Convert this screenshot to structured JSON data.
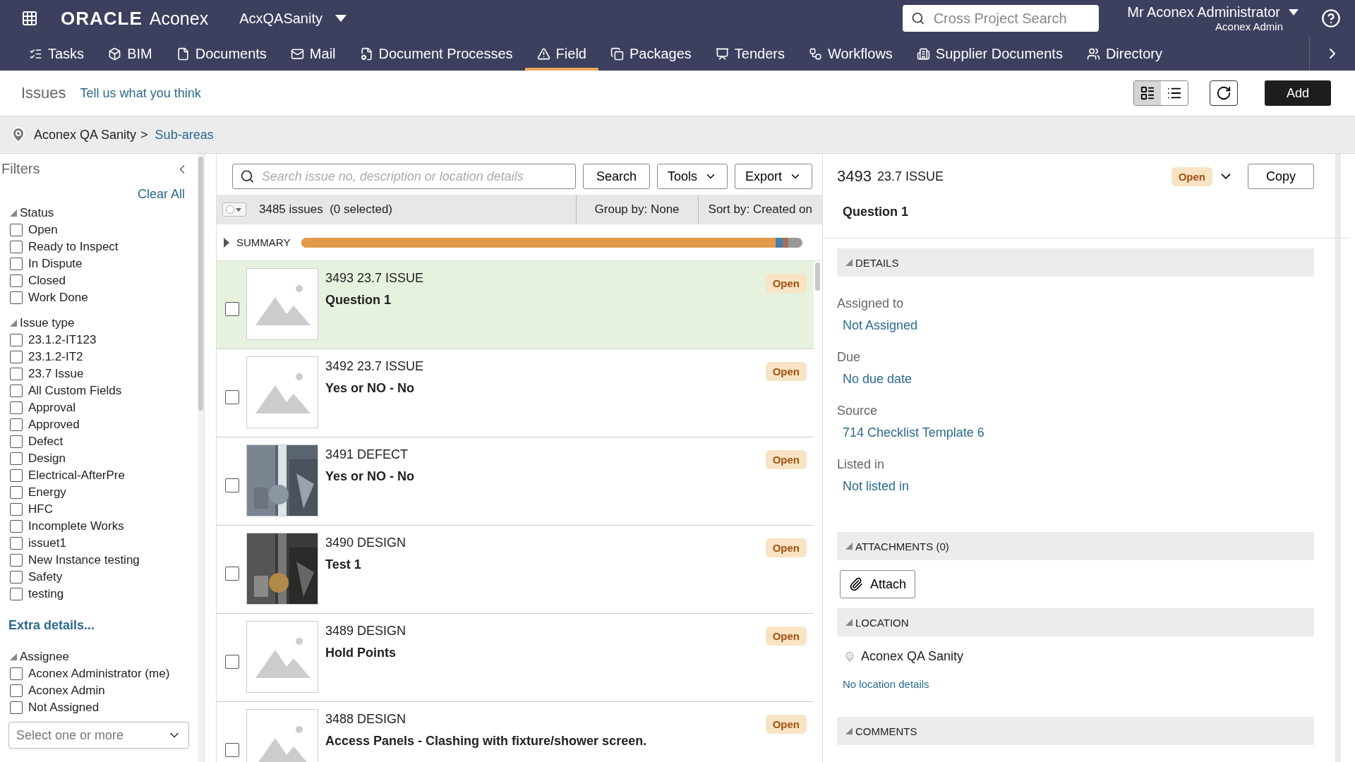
{
  "header": {
    "brand": "ORACLE",
    "product": "Aconex",
    "project": "AcxQASanity",
    "search": {
      "placeholder": "Cross Project Search"
    },
    "user": {
      "name": "Mr Aconex Administrator",
      "org": "Aconex Admin"
    }
  },
  "nav": [
    {
      "label": "Tasks",
      "selected": false
    },
    {
      "label": "BIM",
      "selected": false
    },
    {
      "label": "Documents",
      "selected": false
    },
    {
      "label": "Mail",
      "selected": false
    },
    {
      "label": "Document Processes",
      "selected": false
    },
    {
      "label": "Field",
      "selected": true
    },
    {
      "label": "Packages",
      "selected": false
    },
    {
      "label": "Tenders",
      "selected": false
    },
    {
      "label": "Workflows",
      "selected": false
    },
    {
      "label": "Supplier Documents",
      "selected": false
    },
    {
      "label": "Directory",
      "selected": false
    }
  ],
  "page": {
    "title": "Issues",
    "feedback_link": "Tell us what you think",
    "views": [
      {
        "selected": true
      },
      {
        "selected": false
      }
    ],
    "add_button": "Add"
  },
  "breadcrumb": {
    "root": "Aconex QA Sanity",
    "separator": ">",
    "current": "Sub-areas"
  },
  "filters": {
    "title": "Filters",
    "clear_all": "Clear All",
    "extra_details": "Extra details...",
    "select_placeholder": "Select one or more",
    "groups": [
      {
        "title": "Status",
        "items": [
          {
            "label": "Open",
            "checked": false
          },
          {
            "label": "Ready to Inspect",
            "checked": false
          },
          {
            "label": "In Dispute",
            "checked": false
          },
          {
            "label": "Closed",
            "checked": false
          },
          {
            "label": "Work Done",
            "checked": false
          }
        ]
      },
      {
        "title": "Issue type",
        "items": [
          {
            "label": "23.1.2-IT123",
            "checked": false
          },
          {
            "label": "23.1.2-IT2",
            "checked": false
          },
          {
            "label": "23.7 Issue",
            "checked": false
          },
          {
            "label": "All Custom Fields",
            "checked": false
          },
          {
            "label": "Approval",
            "checked": false
          },
          {
            "label": "Approved",
            "checked": false
          },
          {
            "label": "Defect",
            "checked": false
          },
          {
            "label": "Design",
            "checked": false
          },
          {
            "label": "Electrical-AfterPre",
            "checked": false
          },
          {
            "label": "Energy",
            "checked": false
          },
          {
            "label": "HFC",
            "checked": false
          },
          {
            "label": "Incomplete Works",
            "checked": false
          },
          {
            "label": "issuet1",
            "checked": false
          },
          {
            "label": "New Instance testing",
            "checked": false
          },
          {
            "label": "Safety",
            "checked": false
          },
          {
            "label": "testing",
            "checked": false
          }
        ]
      },
      {
        "title": "Assignee",
        "items": [
          {
            "label": "Aconex Administrator (me)",
            "checked": false
          },
          {
            "label": "Aconex Admin",
            "checked": false
          },
          {
            "label": "Not Assigned",
            "checked": false
          }
        ]
      }
    ]
  },
  "list": {
    "search": {
      "placeholder": "Search issue no, description or location details"
    },
    "search_button": "Search",
    "tools_button": "Tools",
    "export_button": "Export",
    "select_all_checked": false,
    "count": "3485 issues",
    "selected_count": "(0 selected)",
    "group_by": "Group by: None",
    "sort_by": "Sort by: Created on",
    "summary": "SUMMARY",
    "rows": [
      {
        "heading": "3493 23.7 ISSUE",
        "title": "Question 1",
        "status": "Open",
        "kind": "placeholder",
        "selected": true,
        "checked": false
      },
      {
        "heading": "3492 23.7 ISSUE",
        "title": "Yes or NO - No",
        "status": "Open",
        "kind": "placeholder",
        "selected": false,
        "checked": false
      },
      {
        "heading": "3491 DEFECT",
        "title": "Yes or NO - No",
        "status": "Open",
        "kind": "picture",
        "selected": false,
        "checked": false
      },
      {
        "heading": "3490 DESIGN",
        "title": "Test 1",
        "status": "Open",
        "kind": "picture",
        "selected": false,
        "checked": false
      },
      {
        "heading": "3489 DESIGN",
        "title": "Hold Points",
        "status": "Open",
        "kind": "placeholder",
        "selected": false,
        "checked": false
      },
      {
        "heading": "3488 DESIGN",
        "title": "Access Panels - Clashing with fixture/shower screen.",
        "status": "Open",
        "kind": "placeholder",
        "selected": false,
        "checked": false
      }
    ]
  },
  "detail": {
    "number": "3493",
    "type": "23.7 ISSUE",
    "status": "Open",
    "copy_button": "Copy",
    "title": "Question 1",
    "details_header": "DETAILS",
    "fields": [
      {
        "label": "Assigned to",
        "value": "Not Assigned"
      },
      {
        "label": "Due",
        "value": "No due date"
      },
      {
        "label": "Source",
        "value": "714 Checklist Template 6"
      },
      {
        "label": "Listed in",
        "value": "Not listed in"
      }
    ],
    "attachments_header": "ATTACHMENTS (0)",
    "attach_button": "Attach",
    "location_header": "LOCATION",
    "location": "Aconex QA Sanity",
    "location_details": "No location details",
    "comments_header": "COMMENTS"
  }
}
